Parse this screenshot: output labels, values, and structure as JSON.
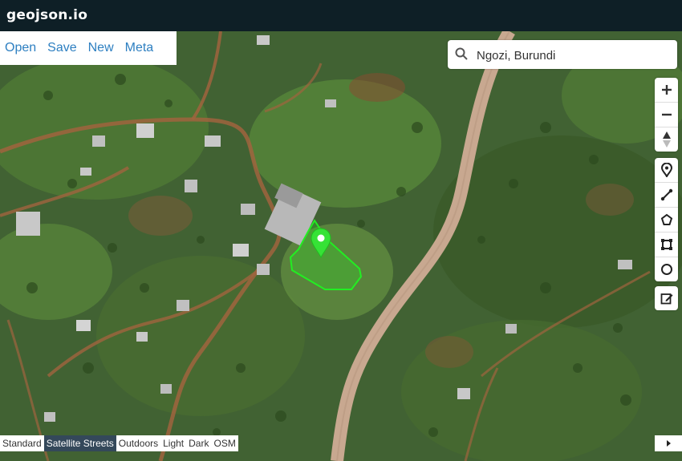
{
  "app": {
    "title": "geojson.io"
  },
  "file_menu": {
    "open": "Open",
    "save": "Save",
    "new": "New",
    "meta": "Meta"
  },
  "search": {
    "value": "Ngozi, Burundi",
    "placeholder": "Search"
  },
  "map_controls": {
    "zoom_in": "zoom-in",
    "zoom_out": "zoom-out",
    "compass": "reset-bearing"
  },
  "draw_tools": [
    "marker",
    "polyline",
    "polygon",
    "rectangle",
    "circle"
  ],
  "edit_tool": "edit-layers",
  "layers": {
    "standard": "Standard",
    "satellite_streets": "Satellite Streets",
    "outdoors": "Outdoors",
    "light": "Light",
    "dark": "Dark",
    "osm": "OSM",
    "active": "Satellite Streets"
  },
  "colors": {
    "topbar": "#0e1f26",
    "link": "#2d7fc1",
    "feature": "#22ee22",
    "marker": "#36e236",
    "active_layer": "#34485a"
  }
}
